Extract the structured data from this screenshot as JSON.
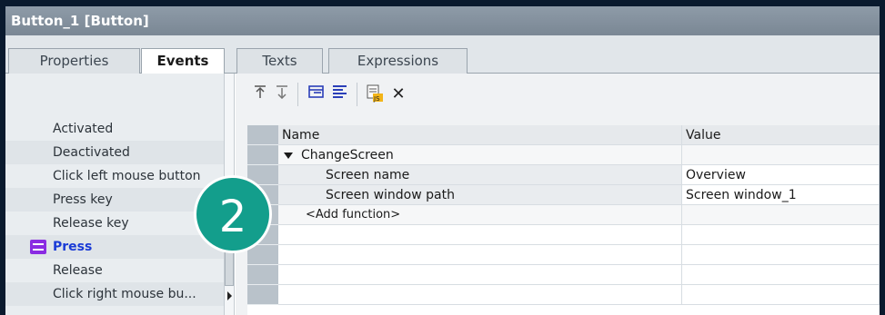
{
  "window": {
    "title": "Button_1 [Button]"
  },
  "tabs": [
    {
      "label": "Properties"
    },
    {
      "label": "Events"
    },
    {
      "label": "Texts"
    },
    {
      "label": "Expressions"
    }
  ],
  "events": [
    {
      "label": "Activated"
    },
    {
      "label": "Deactivated"
    },
    {
      "label": "Click left mouse button"
    },
    {
      "label": "Press key"
    },
    {
      "label": "Release key"
    },
    {
      "label": "Press"
    },
    {
      "label": "Release"
    },
    {
      "label": "Click right mouse bu..."
    }
  ],
  "toolbar": {
    "buttons": [
      {
        "icon": "move-up-icon"
      },
      {
        "icon": "move-down-icon"
      },
      {
        "icon": "collapse-all-icon"
      },
      {
        "icon": "expand-all-icon"
      },
      {
        "icon": "convert-to-script-icon"
      },
      {
        "icon": "delete-icon"
      }
    ]
  },
  "grid": {
    "columns": {
      "name": "Name",
      "value": "Value"
    },
    "rows": [
      {
        "name": "ChangeScreen",
        "value": ""
      },
      {
        "name": "Screen name",
        "value": "Overview"
      },
      {
        "name": "Screen window path",
        "value": "Screen window_1"
      },
      {
        "name": "<Add function>",
        "value": ""
      }
    ]
  },
  "badge": {
    "number": "2"
  },
  "colors": {
    "titlebar": "#8e9ba8",
    "badge": "#139e8c",
    "selected_event": "#1a3bd6"
  }
}
